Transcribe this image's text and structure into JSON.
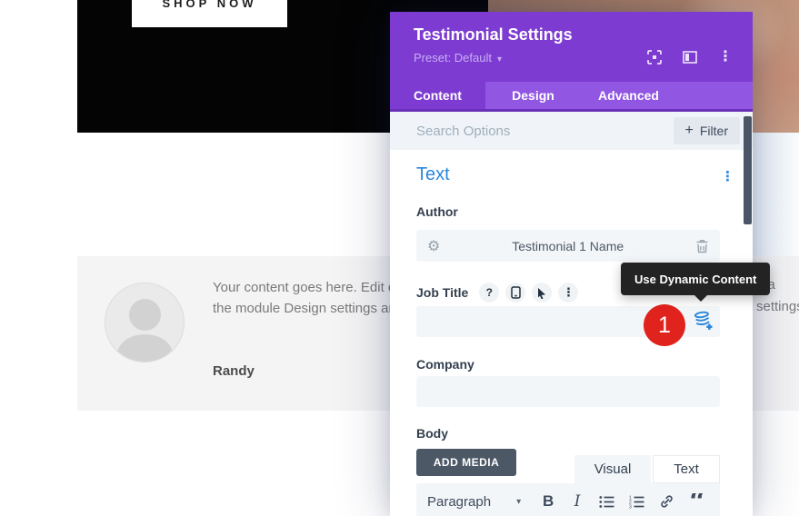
{
  "page": {
    "shop_now_label": "SHOP NOW",
    "testimonial": {
      "text_line1": "Your content goes here. Edit o",
      "text_line2": "the module Design settings ar",
      "text_right_line1": "n a",
      "text_right_line2": "settings",
      "author": "Randy"
    }
  },
  "modal": {
    "title": "Testimonial Settings",
    "preset_label": "Preset: Default",
    "tabs": [
      {
        "label": "Content",
        "active": true
      },
      {
        "label": "Design",
        "active": false
      },
      {
        "label": "Advanced",
        "active": false
      }
    ],
    "search": {
      "placeholder": "Search Options",
      "filter_label": "Filter"
    },
    "section": {
      "title": "Text"
    },
    "fields": {
      "author_label": "Author",
      "author_value": "Testimonial 1 Name",
      "job_title_label": "Job Title",
      "job_title_value": "",
      "company_label": "Company",
      "company_value": "",
      "body_label": "Body"
    },
    "editor": {
      "add_media_label": "ADD MEDIA",
      "visual_tab": "Visual",
      "text_tab": "Text",
      "paragraph_label": "Paragraph"
    },
    "tooltip": {
      "text": "Use Dynamic Content"
    },
    "badge": {
      "value": "1"
    }
  },
  "glyphs": {
    "plus": "+",
    "caret": "▾",
    "ellipsis": "⋮",
    "gear": "⚙",
    "help": "?",
    "bold": "B",
    "italic": "I",
    "quote": "“"
  },
  "colors": {
    "purple_header": "#7d3bd2",
    "purple_tabbar": "#9156e2",
    "purple_tab_border": "#6930b8",
    "accent_blue": "#2b87da",
    "badge_red": "#e0231c",
    "input_bg": "#f3f6f9",
    "dark_button": "#4c5866",
    "tooltip_bg": "#232323",
    "scrollbar": "#4a5565"
  }
}
